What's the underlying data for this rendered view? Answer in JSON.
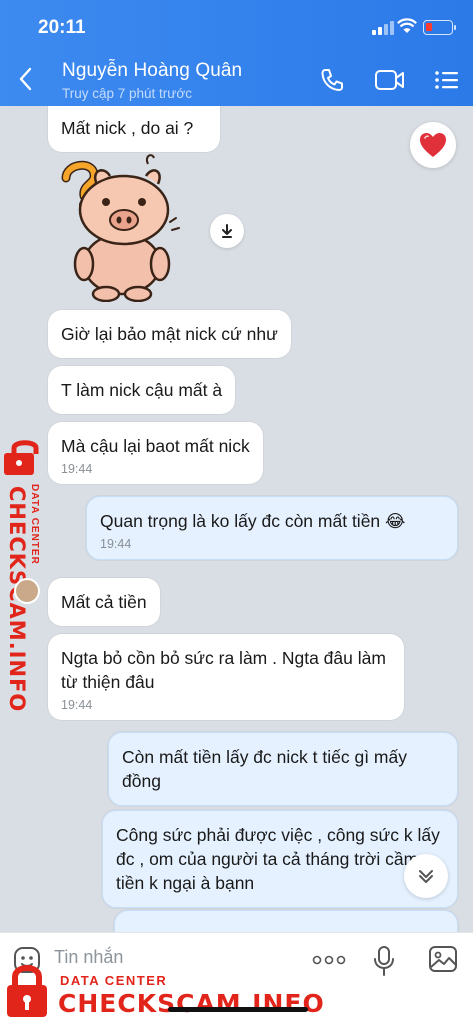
{
  "status_bar": {
    "time": "20:11"
  },
  "header": {
    "contact_name": "Nguyễn Hoàng Quân",
    "contact_status": "Truy cập 7 phút trước"
  },
  "messages": [
    {
      "side": "them",
      "text": "Mất nick , do ai ?",
      "time": ""
    },
    {
      "side": "them",
      "text": "Giờ lại bảo mật nick cứ như",
      "time": ""
    },
    {
      "side": "them",
      "text": "T làm nick cậu mất à",
      "time": ""
    },
    {
      "side": "them",
      "text": "Mà cậu lại baot mất nick",
      "time": "19:44"
    },
    {
      "side": "me",
      "text": "Quan trọng là ko lấy đc còn mất tiền 😂",
      "time": "19:44"
    },
    {
      "side": "them",
      "text": "Mất cả tiền",
      "time": ""
    },
    {
      "side": "them",
      "text": "Ngta bỏ cồn bỏ sức ra làm . Ngta đâu làm từ thiện đâu",
      "time": "19:44"
    },
    {
      "side": "me",
      "text": "Còn mất tiền lấy đc nick t tiếc gì mấy đồng",
      "time": ""
    },
    {
      "side": "me",
      "text": "Công sức phải được việc , công sức k lấy đc , om của người ta cả tháng trời cầm tiền k ngại à bạnn",
      "time": ""
    }
  ],
  "input": {
    "placeholder": "Tin nhắn"
  },
  "watermark": {
    "brand": "CHECKSCAM.INFO",
    "sub": "DATA CENTER"
  },
  "colors": {
    "header": "#2f80ed",
    "my_bubble": "#e5f1ff",
    "watermark": "#e1251b"
  }
}
